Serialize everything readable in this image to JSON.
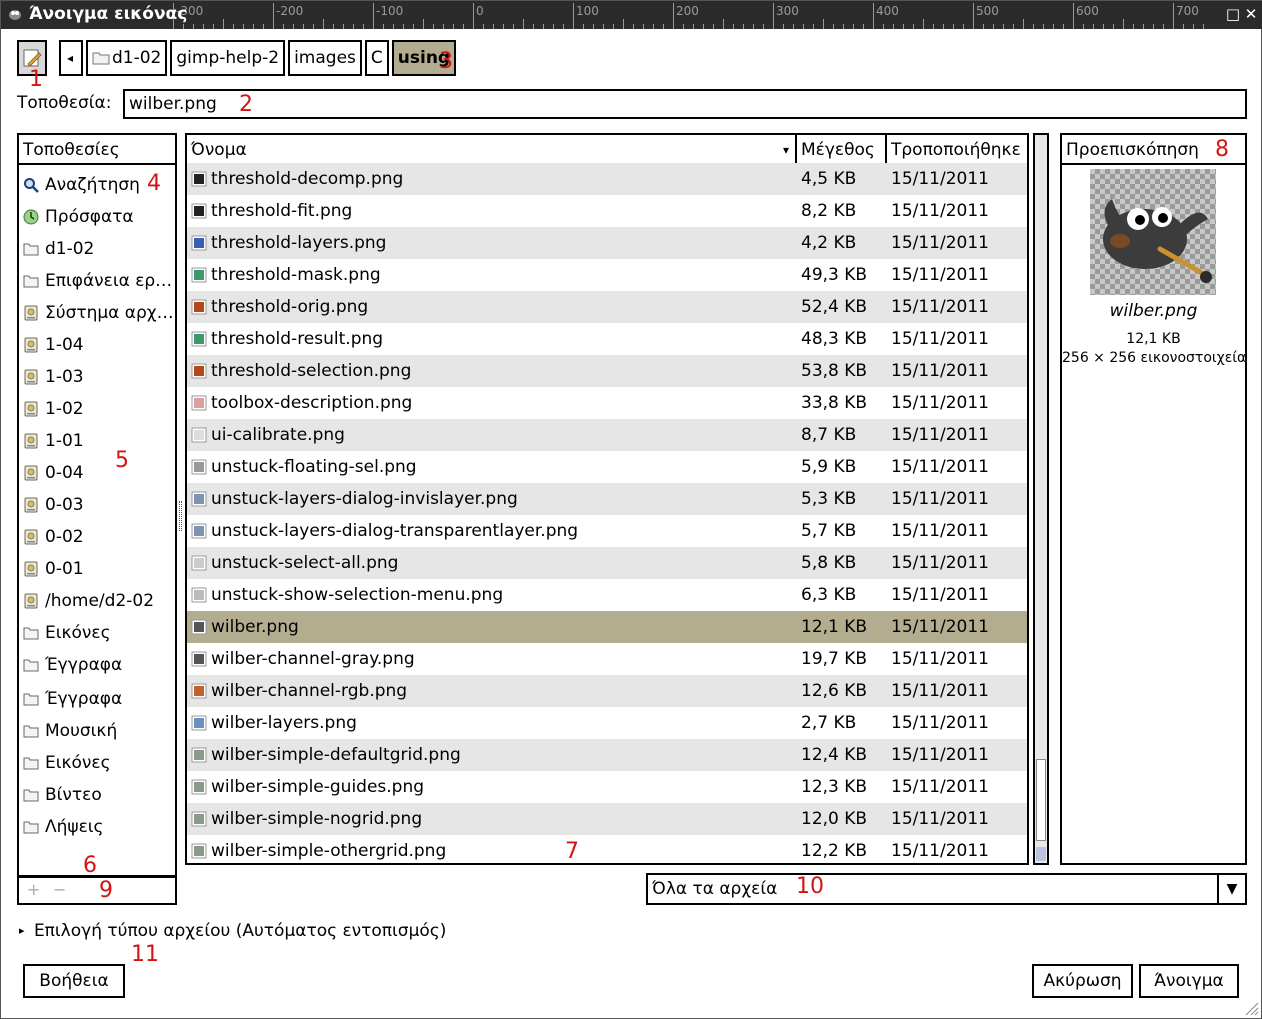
{
  "window": {
    "title": "Άνοιγμα εικόνας"
  },
  "ruler": {
    "labels": [
      "-300",
      "-200",
      "-100",
      "0",
      "100",
      "200",
      "300",
      "400",
      "500",
      "600",
      "700"
    ]
  },
  "titlebar_buttons": {
    "maximize": "□",
    "close": "✕"
  },
  "toolbar": {
    "edit_button_icon": "pencil-icon",
    "breadcrumb_back": "◂",
    "breadcrumbs": [
      "d1-02",
      "gimp-help-2",
      "images",
      "C",
      "using"
    ]
  },
  "location": {
    "label": "Τοποθεσία:",
    "value": "wilber.png"
  },
  "places": {
    "header": "Τοποθεσίες",
    "items": [
      {
        "label": "Αναζήτηση",
        "icon": "search-icon"
      },
      {
        "label": "Πρόσφατα",
        "icon": "recent-icon"
      },
      {
        "label": "d1-02",
        "icon": "folder-icon"
      },
      {
        "label": "Επιφάνεια ερ…",
        "icon": "folder-icon"
      },
      {
        "label": "Σύστημα αρχ…",
        "icon": "drive-icon"
      },
      {
        "label": "1-04",
        "icon": "drive-icon"
      },
      {
        "label": "1-03",
        "icon": "drive-icon"
      },
      {
        "label": "1-02",
        "icon": "drive-icon"
      },
      {
        "label": "1-01",
        "icon": "drive-icon"
      },
      {
        "label": "0-04",
        "icon": "drive-icon"
      },
      {
        "label": "0-03",
        "icon": "drive-icon"
      },
      {
        "label": "0-02",
        "icon": "drive-icon"
      },
      {
        "label": "0-01",
        "icon": "drive-icon"
      },
      {
        "label": "/home/d2-02",
        "icon": "drive-icon"
      },
      {
        "label": "Εικόνες",
        "icon": "folder-icon"
      },
      {
        "label": "Έγγραφα",
        "icon": "folder-icon"
      },
      {
        "label": "Έγγραφα",
        "icon": "folder-icon"
      },
      {
        "label": "Μουσική",
        "icon": "folder-icon"
      },
      {
        "label": "Εικόνες",
        "icon": "folder-icon"
      },
      {
        "label": "Βίντεο",
        "icon": "folder-icon"
      },
      {
        "label": "Λήψεις",
        "icon": "folder-icon"
      }
    ],
    "add": "+",
    "remove": "−"
  },
  "files": {
    "columns": {
      "name": "Όνομα",
      "size": "Μέγεθος",
      "modified": "Τροποποιήθηκε"
    },
    "sort_indicator": "▾",
    "selected_index": 14,
    "rows": [
      {
        "name": "threshold-decomp.png",
        "size": "4,5 KB",
        "modified": "15/11/2011",
        "color": "#222222"
      },
      {
        "name": "threshold-fit.png",
        "size": "8,2 KB",
        "modified": "15/11/2011",
        "color": "#222222"
      },
      {
        "name": "threshold-layers.png",
        "size": "4,2 KB",
        "modified": "15/11/2011",
        "color": "#3a5fb0"
      },
      {
        "name": "threshold-mask.png",
        "size": "49,3 KB",
        "modified": "15/11/2011",
        "color": "#3b9a6a"
      },
      {
        "name": "threshold-orig.png",
        "size": "52,4 KB",
        "modified": "15/11/2011",
        "color": "#b5461e"
      },
      {
        "name": "threshold-result.png",
        "size": "48,3 KB",
        "modified": "15/11/2011",
        "color": "#3b9a6a"
      },
      {
        "name": "threshold-selection.png",
        "size": "53,8 KB",
        "modified": "15/11/2011",
        "color": "#b5461e"
      },
      {
        "name": "toolbox-description.png",
        "size": "33,8 KB",
        "modified": "15/11/2011",
        "color": "#d8a0a0"
      },
      {
        "name": "ui-calibrate.png",
        "size": "8,7 KB",
        "modified": "15/11/2011",
        "color": "#dddddd"
      },
      {
        "name": "unstuck-floating-sel.png",
        "size": "5,9 KB",
        "modified": "15/11/2011",
        "color": "#999999"
      },
      {
        "name": "unstuck-layers-dialog-invislayer.png",
        "size": "5,3 KB",
        "modified": "15/11/2011",
        "color": "#7f93b0"
      },
      {
        "name": "unstuck-layers-dialog-transparentlayer.png",
        "size": "5,7 KB",
        "modified": "15/11/2011",
        "color": "#7f93b0"
      },
      {
        "name": "unstuck-select-all.png",
        "size": "5,8 KB",
        "modified": "15/11/2011",
        "color": "#cccccc"
      },
      {
        "name": "unstuck-show-selection-menu.png",
        "size": "6,3 KB",
        "modified": "15/11/2011",
        "color": "#bbbbbb"
      },
      {
        "name": "wilber.png",
        "size": "12,1 KB",
        "modified": "15/11/2011",
        "color": "#555555"
      },
      {
        "name": "wilber-channel-gray.png",
        "size": "19,7 KB",
        "modified": "15/11/2011",
        "color": "#555555"
      },
      {
        "name": "wilber-channel-rgb.png",
        "size": "12,6 KB",
        "modified": "15/11/2011",
        "color": "#c0632a"
      },
      {
        "name": "wilber-layers.png",
        "size": "2,7 KB",
        "modified": "15/11/2011",
        "color": "#6d8fc2"
      },
      {
        "name": "wilber-simple-defaultgrid.png",
        "size": "12,4 KB",
        "modified": "15/11/2011",
        "color": "#8a9a8a"
      },
      {
        "name": "wilber-simple-guides.png",
        "size": "12,3 KB",
        "modified": "15/11/2011",
        "color": "#8a9a8a"
      },
      {
        "name": "wilber-simple-nogrid.png",
        "size": "12,0 KB",
        "modified": "15/11/2011",
        "color": "#8a9a8a"
      },
      {
        "name": "wilber-simple-othergrid.png",
        "size": "12,2 KB",
        "modified": "15/11/2011",
        "color": "#8a9a8a"
      }
    ]
  },
  "preview": {
    "header": "Προεπισκόπηση",
    "name": "wilber.png",
    "size": "12,1 KB",
    "dims": "256 × 256 εικονοστοιχεία"
  },
  "filter": {
    "value": "Όλα τα αρχεία",
    "arrow": "▼"
  },
  "file_type": {
    "expander": "▸",
    "label": "Επιλογή τύπου αρχείου (Αυτόματος εντοπισμός)"
  },
  "buttons": {
    "help": "Βοήθεια",
    "cancel": "Ακύρωση",
    "open": "Άνοιγμα"
  },
  "annotations": [
    "1",
    "2",
    "3",
    "4",
    "5",
    "6",
    "7",
    "8",
    "9",
    "10",
    "11"
  ],
  "colors": {
    "selection": "#b3ad90",
    "annotation": "#d41414",
    "titlebar": "#2b2b2b"
  }
}
